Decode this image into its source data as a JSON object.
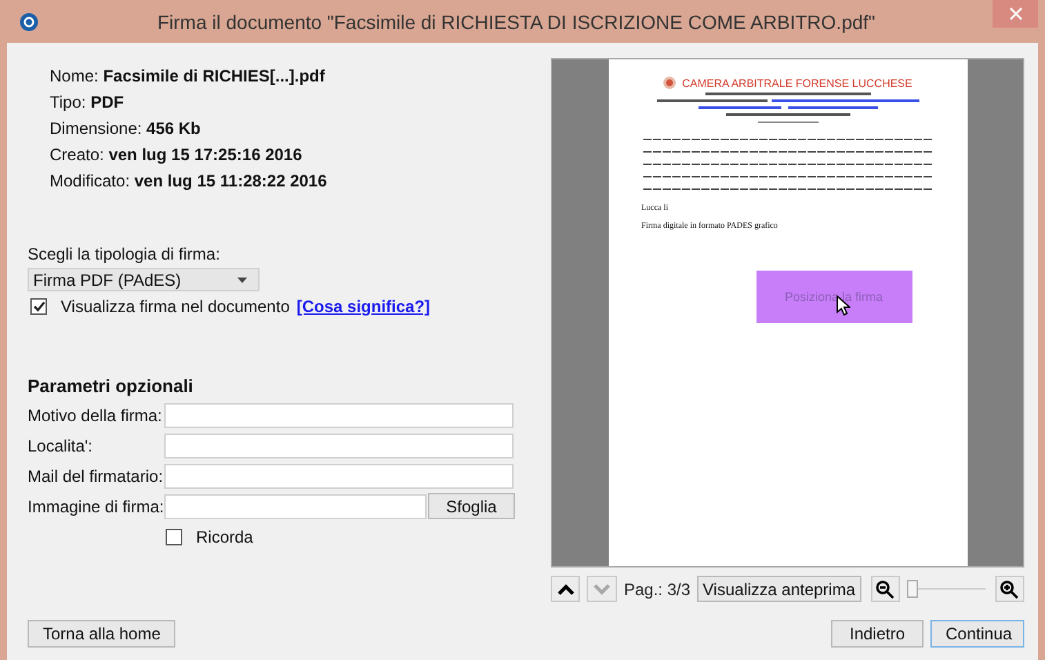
{
  "window": {
    "title": "Firma il documento \"Facsimile di RICHIESTA DI ISCRIZIONE COME ARBITRO.pdf\""
  },
  "file_info": [
    {
      "label": "Nome:",
      "value": "Facsimile di RICHIES[...].pdf"
    },
    {
      "label": "Tipo:",
      "value": "PDF"
    },
    {
      "label": "Dimensione:",
      "value": "456 Kb"
    },
    {
      "label": "Creato:",
      "value": "ven lug 15 17:25:16 2016"
    },
    {
      "label": "Modificato:",
      "value": "ven lug 15 11:28:22 2016"
    }
  ],
  "signature_type": {
    "label": "Scegli la tipologia di firma:",
    "value": "Firma PDF (PAdES)"
  },
  "show_signature": {
    "checked": true,
    "label": "Visualizza firma nel documento",
    "link": "[Cosa significa?]"
  },
  "optional": {
    "title": "Parametri opzionali",
    "fields": [
      {
        "kind": "text",
        "label": "Motivo della firma:"
      },
      {
        "kind": "text",
        "label": "Localita':"
      },
      {
        "kind": "text",
        "label": "Mail del firmatario:"
      },
      {
        "kind": "file",
        "label": "Immagine di firma:",
        "button": "Sfoglia"
      }
    ],
    "remember": {
      "checked": false,
      "label": "Ricorda"
    }
  },
  "preview": {
    "header": "CAMERA ARBITRALE FORENSE LUCCHESE",
    "place": "Lucca li",
    "note": "Firma digitale in formato PADES grafico",
    "signature_box": "Posiziona la firma"
  },
  "page_nav": {
    "up_disabled": false,
    "down_disabled": true,
    "page": "Pag.: 3/3",
    "preview_button": "Visualizza anteprima",
    "zoom": {
      "level": 0
    }
  },
  "buttons": {
    "home": "Torna alla home",
    "back": "Indietro",
    "continue": "Continua"
  }
}
